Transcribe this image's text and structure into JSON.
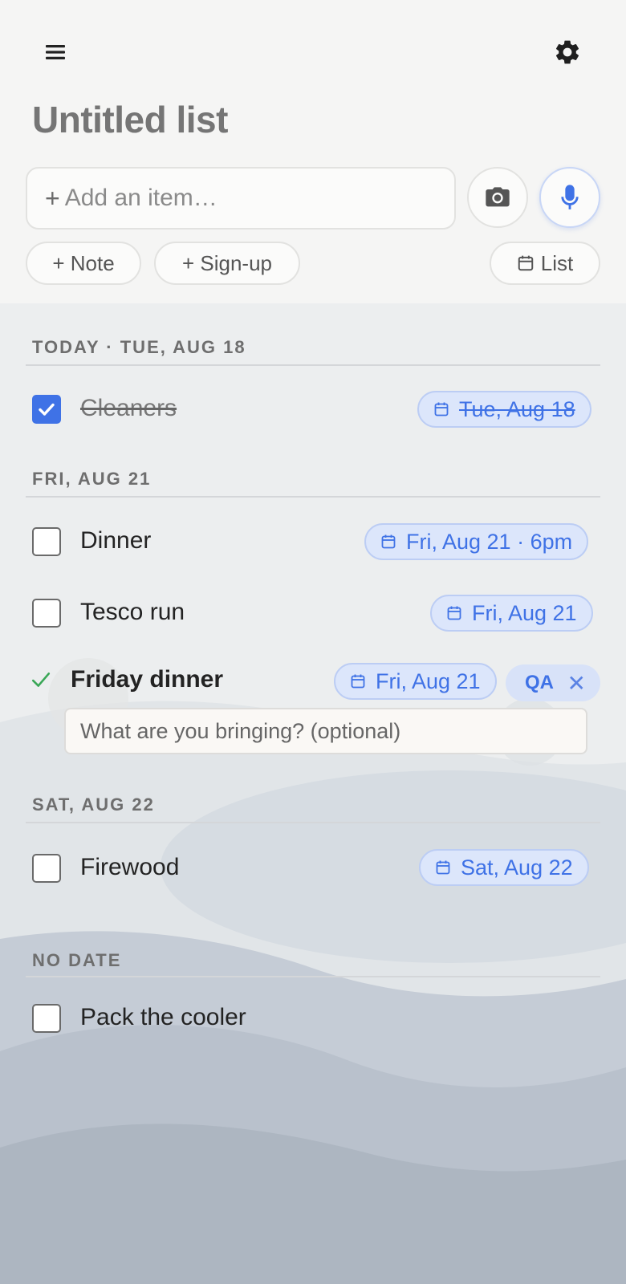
{
  "header": {
    "menu_icon": "hamburger-menu-icon",
    "settings_icon": "gear-icon",
    "title": "Untitled list",
    "add_placeholder": "Add an item…",
    "add_plus": "+",
    "camera_icon": "camera-icon",
    "mic_icon": "microphone-icon",
    "note_label": "+ Note",
    "signup_label": "+ Sign-up",
    "list_label": "List",
    "list_icon": "calendar-icon"
  },
  "sections": [
    {
      "heading": "TODAY · TUE, AUG 18",
      "items": [
        {
          "label": "Cleaners",
          "checked": true,
          "date": "Tue, Aug 18"
        }
      ]
    },
    {
      "heading": "FRI, AUG 21",
      "items": [
        {
          "label": "Dinner",
          "checked": false,
          "date": "Fri, Aug 21 · 6pm"
        },
        {
          "label": "Tesco run",
          "checked": false,
          "date": "Fri, Aug 21"
        },
        {
          "label": "Friday dinner",
          "signup": true,
          "date": "Fri, Aug 21",
          "assignee": "QA",
          "assignee_remove": "✕",
          "prompt_placeholder": "What are you bringing? (optional)"
        }
      ]
    },
    {
      "heading": "SAT, AUG 22",
      "items": [
        {
          "label": "Firewood",
          "checked": false,
          "date": "Sat, Aug 22"
        }
      ]
    },
    {
      "heading": "NO DATE",
      "items": [
        {
          "label": "Pack the cooler",
          "checked": false
        }
      ]
    }
  ],
  "colors": {
    "accent": "#3f72e6",
    "chip_bg": "#dce6fb",
    "check_green": "#3aa757",
    "title_gray": "#757575"
  }
}
